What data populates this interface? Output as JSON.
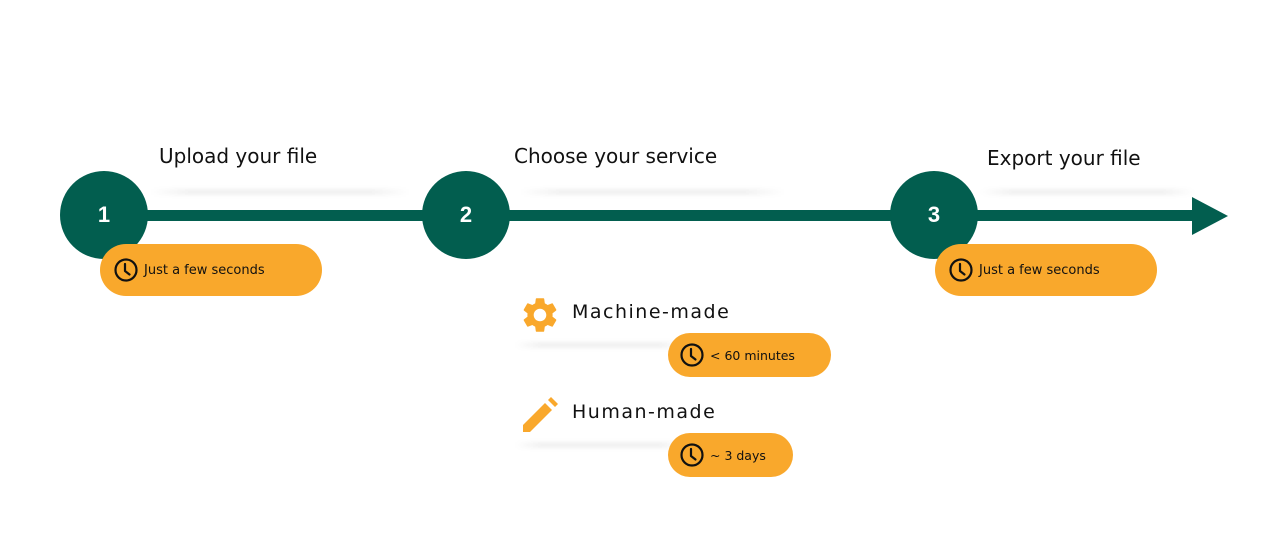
{
  "colors": {
    "primary": "#025e4f",
    "accent": "#f9a82c",
    "text": "#111111"
  },
  "steps": [
    {
      "number": "1",
      "title": "Upload your file",
      "duration": "Just a few seconds",
      "duration_icon": "clock-icon"
    },
    {
      "number": "2",
      "title": "Choose your service",
      "services": [
        {
          "icon": "gear-icon",
          "label": "Machine-made",
          "duration": "< 60 minutes",
          "duration_icon": "clock-icon"
        },
        {
          "icon": "pencil-icon",
          "label": "Human-made",
          "duration": "~ 3 days",
          "duration_icon": "clock-icon"
        }
      ]
    },
    {
      "number": "3",
      "title": "Export your file",
      "duration": "Just a few seconds",
      "duration_icon": "clock-icon"
    }
  ]
}
